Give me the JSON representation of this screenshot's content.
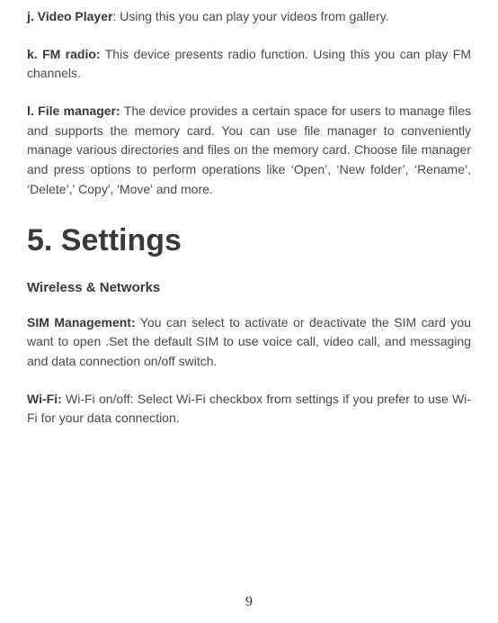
{
  "items": {
    "j": {
      "label": "j. Video Player",
      "sep": ": ",
      "text": "Using this you can play your videos from gallery."
    },
    "k": {
      "label": "k. FM radio:",
      "sep": " ",
      "text": "This device presents radio function. Using this you can play FM channels."
    },
    "l": {
      "label": "l. File manager:",
      "sep": " ",
      "text": "The device  provides a certain space for users to manage files and supports the memory card. You can use file manager to conveniently manage various directories and files on the memory card. Choose file manager and press options to perform operations like ‘Open’, ‘New folder’, ‘Rename’, ‘Delete’,' Copy', 'Move' and more."
    }
  },
  "section": {
    "heading": "5. Settings",
    "sub1": "Wireless & Networks"
  },
  "settings": {
    "sim": {
      "label": "SIM Management:",
      "sep": " ",
      "text": "You can select to activate or deactivate the SIM card you want to open .Set the default SIM to use voice call, video call, and messaging and data connection on/off switch."
    },
    "wifi": {
      "label": "Wi-Fi:",
      "sep": " ",
      "text": "Wi-Fi on/off: Select Wi-Fi checkbox from settings if you prefer to use Wi-Fi for your data connection."
    }
  },
  "page_number": "9"
}
